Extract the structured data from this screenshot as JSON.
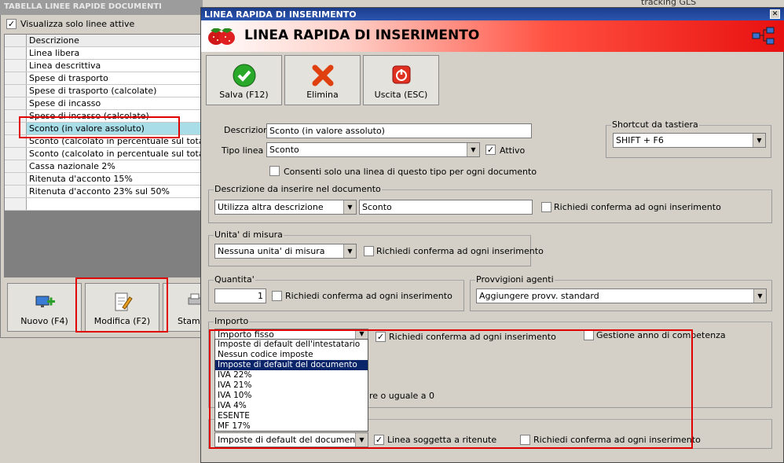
{
  "bg_window": {
    "title": "TABELLA LINEE RAPIDE DOCUMENTI",
    "only_active_label": "Visualizza solo linee attive",
    "column_header": "Descrizione",
    "rows": [
      "Linea libera",
      "Linea descrittiva",
      "Spese di trasporto",
      "Spese di trasporto (calcolate)",
      "Spese di incasso",
      "Spese di incasso (calcolate)",
      "Sconto (in valore assoluto)",
      "Sconto (calcolato in percentuale sul totale co",
      "Sconto (calcolato in percentuale sul totale co",
      "Cassa nazionale 2%",
      "Ritenuta d'acconto 15%",
      "Ritenuta d'acconto 23% sul 50%"
    ],
    "selected_index": 6,
    "new_button": "Nuovo (F4)",
    "edit_button": "Modifica (F2)",
    "print_button": "Stamp",
    "far_right_text": "tracking GLS"
  },
  "dialog": {
    "window_title": "LINEA RAPIDA DI INSERIMENTO",
    "header_title": "LINEA RAPIDA DI INSERIMENTO",
    "toolbar": {
      "save": "Salva (F12)",
      "delete": "Elimina",
      "exit": "Uscita (ESC)"
    },
    "descrizione_label": "Descrizione :",
    "descrizione_value": "Sconto (in valore assoluto)",
    "tipo_linea_label": "Tipo linea :",
    "tipo_linea_value": "Sconto",
    "attivo_label": "Attivo",
    "consenti_label": "Consenti solo una linea di questo tipo per ogni documento",
    "shortcut_group": "Shortcut da tastiera",
    "shortcut_value": "SHIFT + F6",
    "desc_doc_group": "Descrizione da inserire nel documento",
    "desc_doc_combo": "Utilizza altra descrizione",
    "desc_doc_text": "Sconto",
    "richiedi_label": "Richiedi conferma ad ogni inserimento",
    "um_group": "Unita' di misura",
    "um_combo": "Nessuna unita' di misura",
    "qta_group": "Quantita'",
    "qta_value": "1",
    "provv_group": "Provvigioni agenti",
    "provv_value": "Aggiungere provv. standard",
    "importo_group": "Importo",
    "importo_combo": "Importo fisso",
    "gestione_label": "Gestione anno di competenza",
    "partial_text": "re o uguale a 0",
    "imposte_combo": "Imposte di default del documento",
    "ritenute_label": "Linea soggetta a ritenute",
    "dropdown_options": [
      "Imposte di default dell'intestatario",
      "Nessun codice imposte",
      "Imposte di default del documento",
      "IVA 22%",
      "IVA 21%",
      "IVA 10%",
      "IVA 4%",
      "ESENTE",
      "MF 17%"
    ],
    "dropdown_selected_index": 2
  },
  "colors": {
    "highlight_red": "#e00000",
    "selection_blue": "#0a246a",
    "row_selected": "#a9dde8"
  }
}
